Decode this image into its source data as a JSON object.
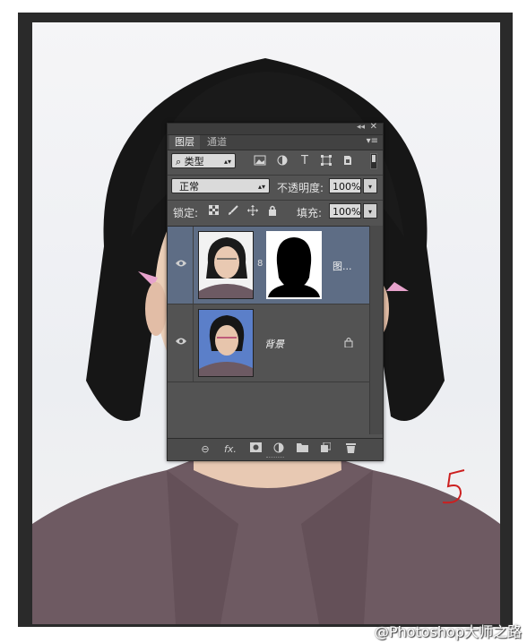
{
  "watermark": "@Photoshop大师之路",
  "annotation_mark": "5",
  "panel": {
    "tabs": [
      {
        "label": "图层",
        "active": true
      },
      {
        "label": "通道",
        "active": false
      }
    ],
    "filter": {
      "kind_label": "类型",
      "icons": [
        "image-filter-icon",
        "adjustment-filter-icon",
        "type-filter-icon",
        "shape-filter-icon",
        "smart-object-filter-icon"
      ],
      "type_icon_text": "T"
    },
    "blend_mode": "正常",
    "opacity_label": "不透明度:",
    "opacity_value": "100%",
    "lock_label": "锁定:",
    "lock_icons": [
      "lock-transparent-icon",
      "lock-image-icon",
      "lock-position-icon",
      "lock-all-icon"
    ],
    "fill_label": "填充:",
    "fill_value": "100%",
    "layers": [
      {
        "name": "图...",
        "selected": true,
        "visible": true,
        "has_mask": true,
        "locked": false
      },
      {
        "name": "背景",
        "selected": false,
        "visible": true,
        "has_mask": false,
        "locked": true
      }
    ],
    "footer_icons": [
      "link-layers-icon",
      "fx-icon",
      "add-mask-icon",
      "adjustment-layer-icon",
      "new-group-icon",
      "new-layer-icon",
      "delete-layer-icon"
    ],
    "footer_fx_text": "fx."
  },
  "colors": {
    "panel_bg": "#535353",
    "selected_layer": "#5e6d85",
    "thumb_blue_bg": "#5b7fc9"
  }
}
